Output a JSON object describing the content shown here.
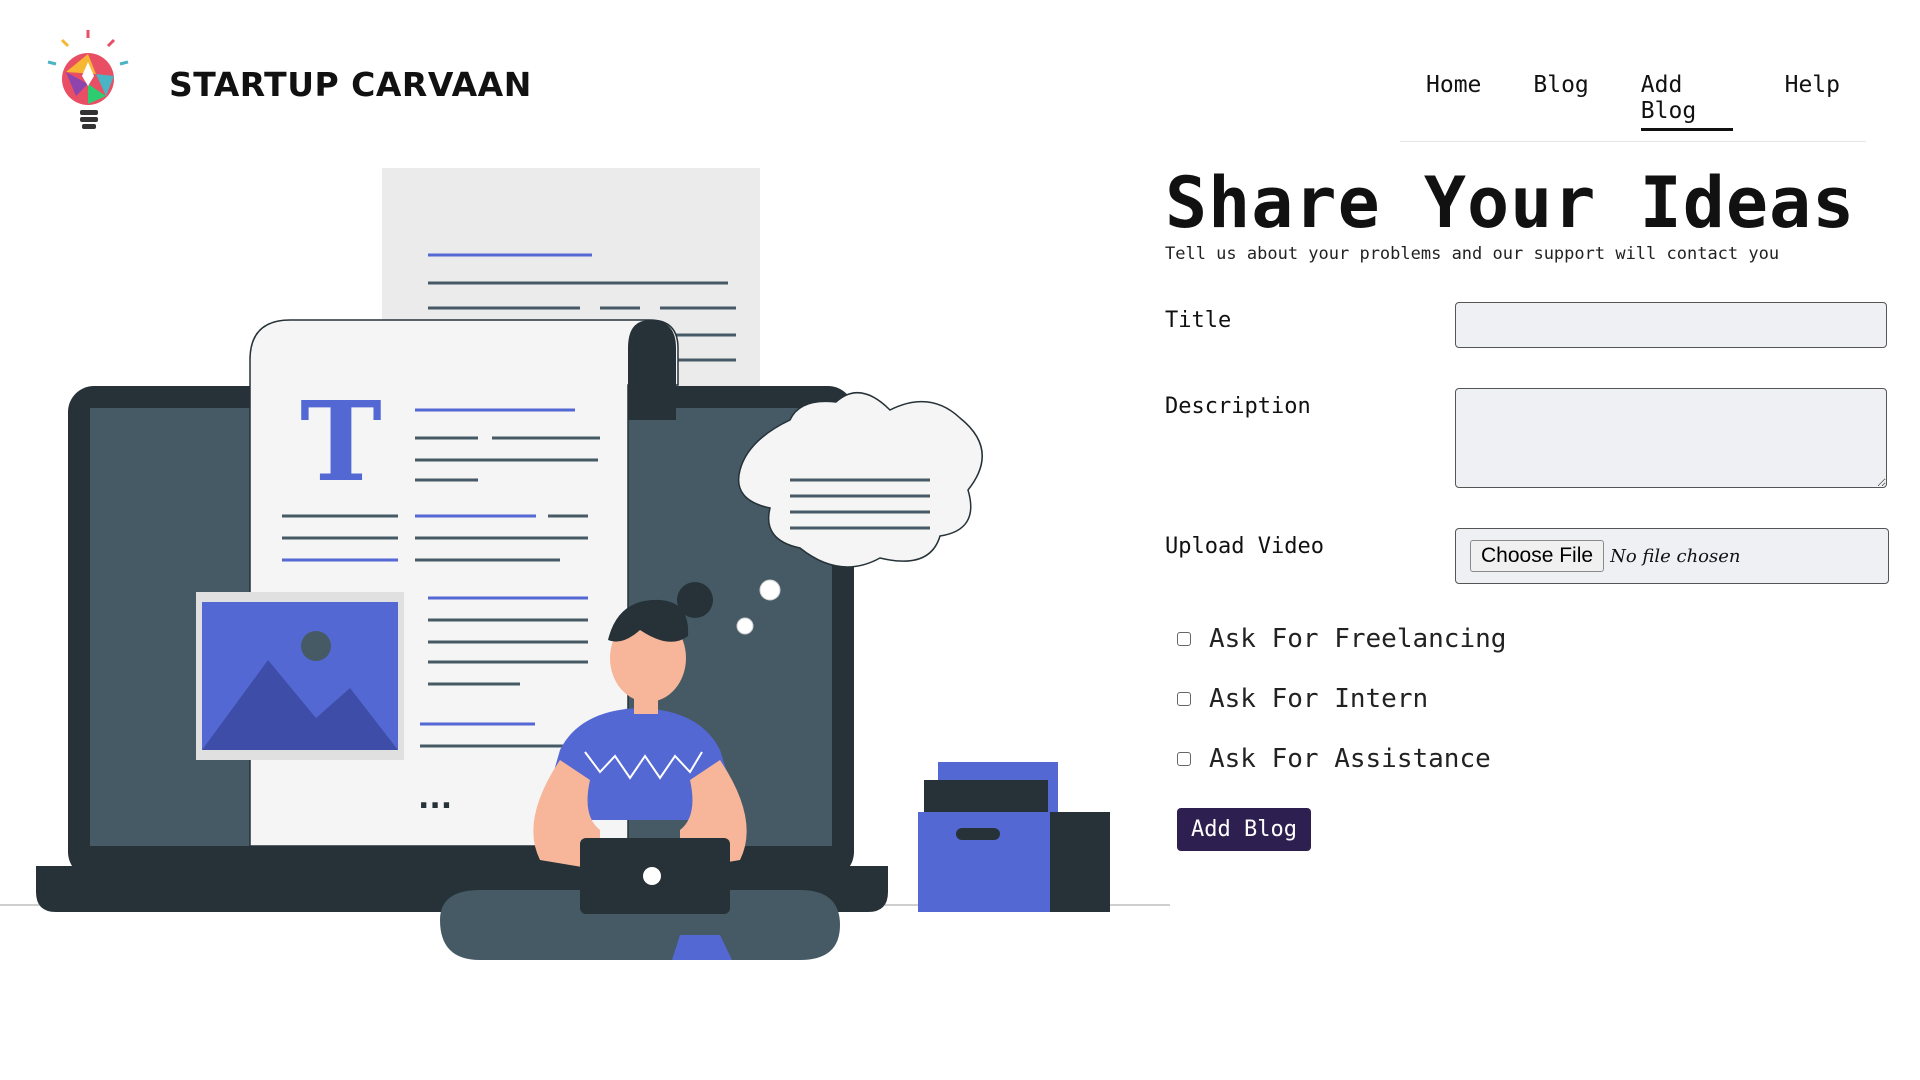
{
  "brand": {
    "name": "STARTUP CARVAAN"
  },
  "nav": {
    "items": [
      {
        "label": "Home"
      },
      {
        "label": "Blog"
      },
      {
        "label": "Add Blog"
      },
      {
        "label": "Help"
      }
    ],
    "active": "Add Blog"
  },
  "form": {
    "title": "Share Your Ideas",
    "subtitle": "Tell us about your problems and our support will contact you",
    "fields": {
      "title_label": "Title",
      "title_value": "",
      "description_label": "Description",
      "description_value": "",
      "upload_label": "Upload Video",
      "upload_button": "Choose File",
      "upload_status": "No file chosen"
    },
    "checkboxes": [
      {
        "label": "Ask For Freelancing",
        "checked": false
      },
      {
        "label": "Ask For Intern",
        "checked": false
      },
      {
        "label": "Ask For Assistance",
        "checked": false
      }
    ],
    "submit_label": "Add Blog"
  },
  "illustration": {
    "doc_letter": "T",
    "ellipsis": "...",
    "colors": {
      "accent": "#5468d4",
      "dark": "#263238",
      "screen": "#455a64",
      "paper": "#f5f5f5"
    }
  },
  "colors": {
    "submit_bg": "#2d1f4f",
    "field_bg": "#eef0f3"
  }
}
